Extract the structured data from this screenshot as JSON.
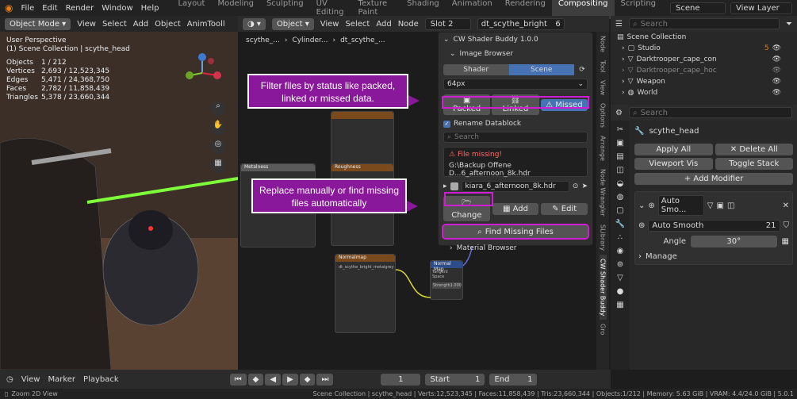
{
  "topmenu": [
    "File",
    "Edit",
    "Render",
    "Window",
    "Help"
  ],
  "workspaces": [
    "Layout",
    "Modeling",
    "Sculpting",
    "UV Editing",
    "Texture Paint",
    "Shading",
    "Animation",
    "Rendering",
    "Compositing",
    "Scripting"
  ],
  "active_workspace": "Compositing",
  "scene": "Scene",
  "view_layer": "View Layer",
  "viewport": {
    "mode": "Object Mode",
    "menus": [
      "View",
      "Select",
      "Add",
      "Object",
      "AnimTooll"
    ],
    "title": "User Perspective",
    "collection": "(1) Scene Collection | scythe_head",
    "stats": [
      {
        "k": "Objects",
        "v": "1 / 212"
      },
      {
        "k": "Vertices",
        "v": "2,693 / 12,523,345"
      },
      {
        "k": "Edges",
        "v": "5,471 / 24,368,750"
      },
      {
        "k": "Faces",
        "v": "2,782 / 11,858,439"
      },
      {
        "k": "Triangles",
        "v": "5,378 / 23,660,344"
      }
    ]
  },
  "node_editor": {
    "type": "Object",
    "menus": [
      "View",
      "Select",
      "Add",
      "Node"
    ],
    "slot": "Slot 2",
    "material": "dt_scythe_bright",
    "users": "6",
    "breadcrumb": [
      "scythe_...",
      "Cylinder...",
      "dt_scythe_..."
    ],
    "nodes": {
      "metalness": "Metalness",
      "roughness": "Roughness",
      "normalmap": "Normalmap",
      "normal_map": "Normal Map",
      "img": "dt_scythe_bright_metalgrey",
      "strength": "Strength",
      "strength_val": "1.000",
      "tangent": "Tangent Space"
    }
  },
  "shader_buddy": {
    "title": "CW Shader Buddy 1.0.0",
    "image_browser": "Image Browser",
    "tab_shader": "Shader",
    "tab_scene": "Scene",
    "size": "64px",
    "filter_packed": "Packed",
    "filter_linked": "Linked",
    "filter_missed": "Missed",
    "rename": "Rename Datablock",
    "search_placeholder": "Search",
    "missing_label": "File missing!",
    "missing_path": "G:\\Backup Offene D...6_afternoon_8k.hdr",
    "file_name": "kiara_6_afternoon_8k.hdr",
    "change": "Change",
    "add": "Add",
    "edit": "Edit",
    "find_missing": "Find Missing Files",
    "material_browser": "Material Browser"
  },
  "callouts": {
    "filter": "Filter files by status like packed, linked or missed data.",
    "replace": "Replace manually or find missing files automatically"
  },
  "side_tabs": [
    "Node",
    "Tool",
    "View",
    "Options",
    "Arrange",
    "Node Wrangler",
    "SLibrary",
    "CW Shader Buddy",
    "Gro"
  ],
  "outliner": {
    "search_placeholder": "Search",
    "root": "Scene Collection",
    "items": [
      "Studio",
      "Darktrooper_cape_con",
      "Darktrooper_cape_hoc",
      "Weapon",
      "World"
    ],
    "studio_count": "5"
  },
  "properties": {
    "search_placeholder": "Search",
    "object": "scythe_head",
    "apply_all": "Apply All",
    "delete_all": "Delete All",
    "viewport_vis": "Viewport Vis",
    "toggle_stack": "Toggle Stack",
    "add_modifier": "Add Modifier",
    "modifier": "Auto Smo...",
    "modifier_group": "Auto Smooth",
    "group_users": "21",
    "angle_label": "Angle",
    "angle_value": "30°",
    "manage": "Manage"
  },
  "timeline": {
    "menus": [
      "View",
      "Marker",
      "Playback"
    ],
    "frame": "1",
    "start_label": "Start",
    "start": "1",
    "end_label": "End",
    "end": "1"
  },
  "status": {
    "left": "Zoom 2D View",
    "info": "Scene Collection | scythe_head | Verts:12,523,345 | Faces:11,858,439 | Tris:23,660,344 | Objects:1/212 | Memory: 5.63 GiB | VRAM: 4.4/24.0 GiB | 5.0.1"
  }
}
